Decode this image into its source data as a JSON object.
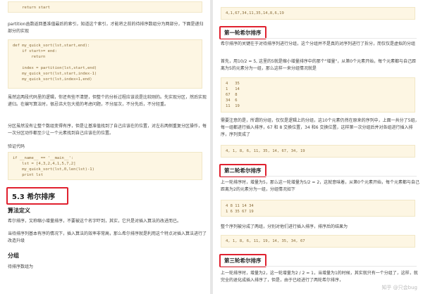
{
  "left": {
    "code_top": "    return start",
    "p1": "partition函数返回基准值最后的索引，知道这个索引，才能将之前的待排序数组分为两部分，下面是递归部分的实现",
    "code_recursive": "def my_quick_sort(lst,start,end):\n    if start>= end:\n        return\n\n    index = partition(lst,start,end)\n    my_quick_sort(lst,start,index-1)\n    my_quick_sort(lst,index+1,end)",
    "p2": "虽然这两段代码里的逻辑，你还有些不清楚，但整个的分析过程应该说是比较刚的。先实现分区，然后实现递归。在编写算法时，很忌讳大包大揽的考虑问题，不分层次，不分先后，不分轻重。",
    "p3": "分区虽然没有让整个数组变得有序，但是让基准值找到了自己应该在的位置，对左右两侧重复分区操作，每一次分区动作都至少让一个元素找到自己应该在的位置。",
    "p4": "验证代码",
    "code_verify": "if __name__ == '__main__':\n    lst = [4,3,2,4,1,5,7,2]\n    my_quick_sort(lst,0,len(lst)-1)\n    print lst",
    "section_title": "5.3 希尔排序",
    "algo_heading": "算法定义",
    "p5": "希尔排序，又称缩小增量排序，不要被这个名字吓到，其实，它只是对插入算法的改进而已。",
    "p6": "当待排序列基本有序的情况下，插入算法的效率非常高，那么希尔排序就是利用这个特点对插入算法进行了改造升级",
    "group_heading": "分组",
    "p7": "待排序数组为"
  },
  "right": {
    "code_array": "4,1,67,34,11,35,14,8,6,19",
    "round1_title": "第一轮希尔排序",
    "r1": "希尔排序的关键在于对待排序列进行分组，这个分组并不是真的对序列进行了拆分，而仅仅是虚拟的分组",
    "r2": "首先，用10/2 = 5, 这里的5就是缩小增量排序中的那个\"增量\"，从第0个元素开始，每个元素都与自己距离为5的元素分为一组，那么这样一来分组情况就是",
    "code_groups1": "4   35\n1   14\n67  8\n34  6\n11  19",
    "r3": "需要注意的是，所谓的分组，仅仅是逻辑上的分组，这10个元素仍然在原来的序列中，上面一共分了5组，每一组都进行插入排序，67 和 8 交换位置，34 和6 交换位置，这样第一次分组后并对各组进行插入排序，序列变成了",
    "code_result1": "4, 1, 8, 6, 11, 35, 14, 67, 34, 19",
    "round2_title": "第二轮希尔排序",
    "r4": "上一轮排序时，增量为5，那么这一轮增量为5/2 = 2，这就意味着，从第0个元素开始，每个元素都与自己距离为2的元素分为一组，分组情况如下",
    "code_groups2": "4 8 11 14 34\n1 6 35 67 19",
    "r5": "整个序列被分成了两组，分别对他们进行插入排序，排序后的结果为",
    "code_result2": "4, 1, 8, 6, 11, 19, 14, 35, 34, 67",
    "round3_title": "第三轮希尔排序",
    "r6": "上一轮排序时，增量为2，这一轮增量为2 / 2 = 1，当增量为1的时候，其实就只有一个分组了，这样，就完全的退化成插入排序了，但是，由于已经进行了两轮希尔排序，"
  },
  "watermark": "知乎 @只会bug"
}
